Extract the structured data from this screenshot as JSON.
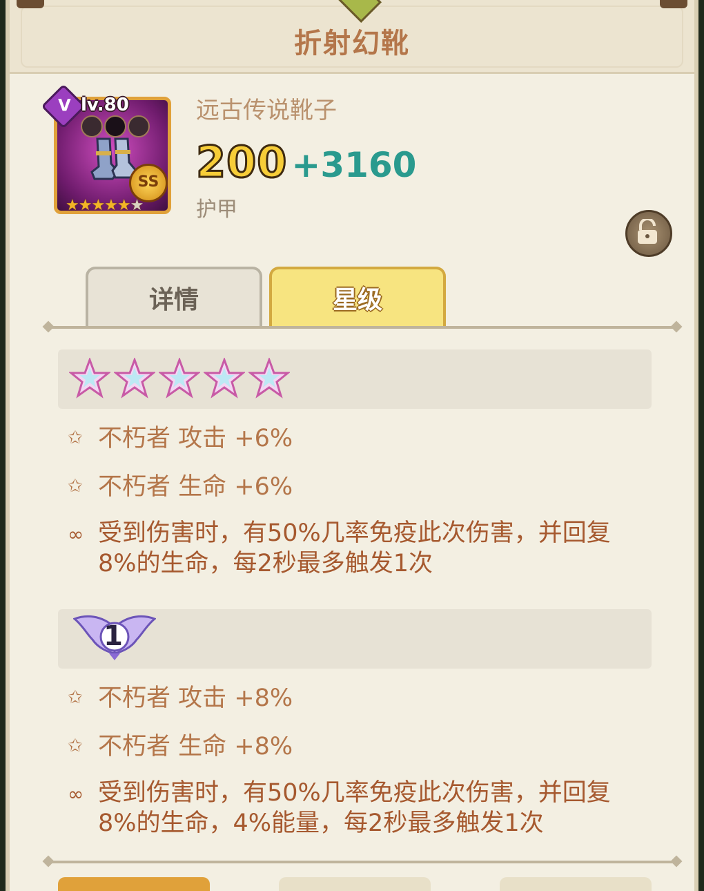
{
  "title": "折射幻靴",
  "item": {
    "vip_badge": "V",
    "level": "lv.80",
    "grade_badge": "SS",
    "item_stars": 5,
    "rarity": "远古传说靴子",
    "base_value": "200",
    "bonus_value": "+3160",
    "stat_type": "护甲"
  },
  "tabs": [
    {
      "label": "详情",
      "active": false
    },
    {
      "label": "星级",
      "active": true
    }
  ],
  "tiers": [
    {
      "kind": "stars",
      "star_count": 5,
      "bonuses": [
        "不朽者 攻击 +6%",
        "不朽者 生命 +6%"
      ],
      "effect": "受到伤害时，有50%几率免疫此次伤害，并回复8%的生命，每2秒最多触发1次"
    },
    {
      "kind": "wings",
      "wing_level": "1",
      "bonuses": [
        "不朽者 攻击 +8%",
        "不朽者 生命 +8%"
      ],
      "effect": "受到伤害时，有50%几率免疫此次伤害，并回复8%的生命，4%能量，每2秒最多触发1次"
    }
  ],
  "icons": {
    "bonus": "star-outline-icon",
    "effect": "link-icon",
    "lock": "unlock-icon"
  },
  "colors": {
    "title": "#b4764a",
    "bonus_text": "#2a9a8e",
    "base_text": "#f7cd38",
    "active_tab": "#f7e480"
  }
}
